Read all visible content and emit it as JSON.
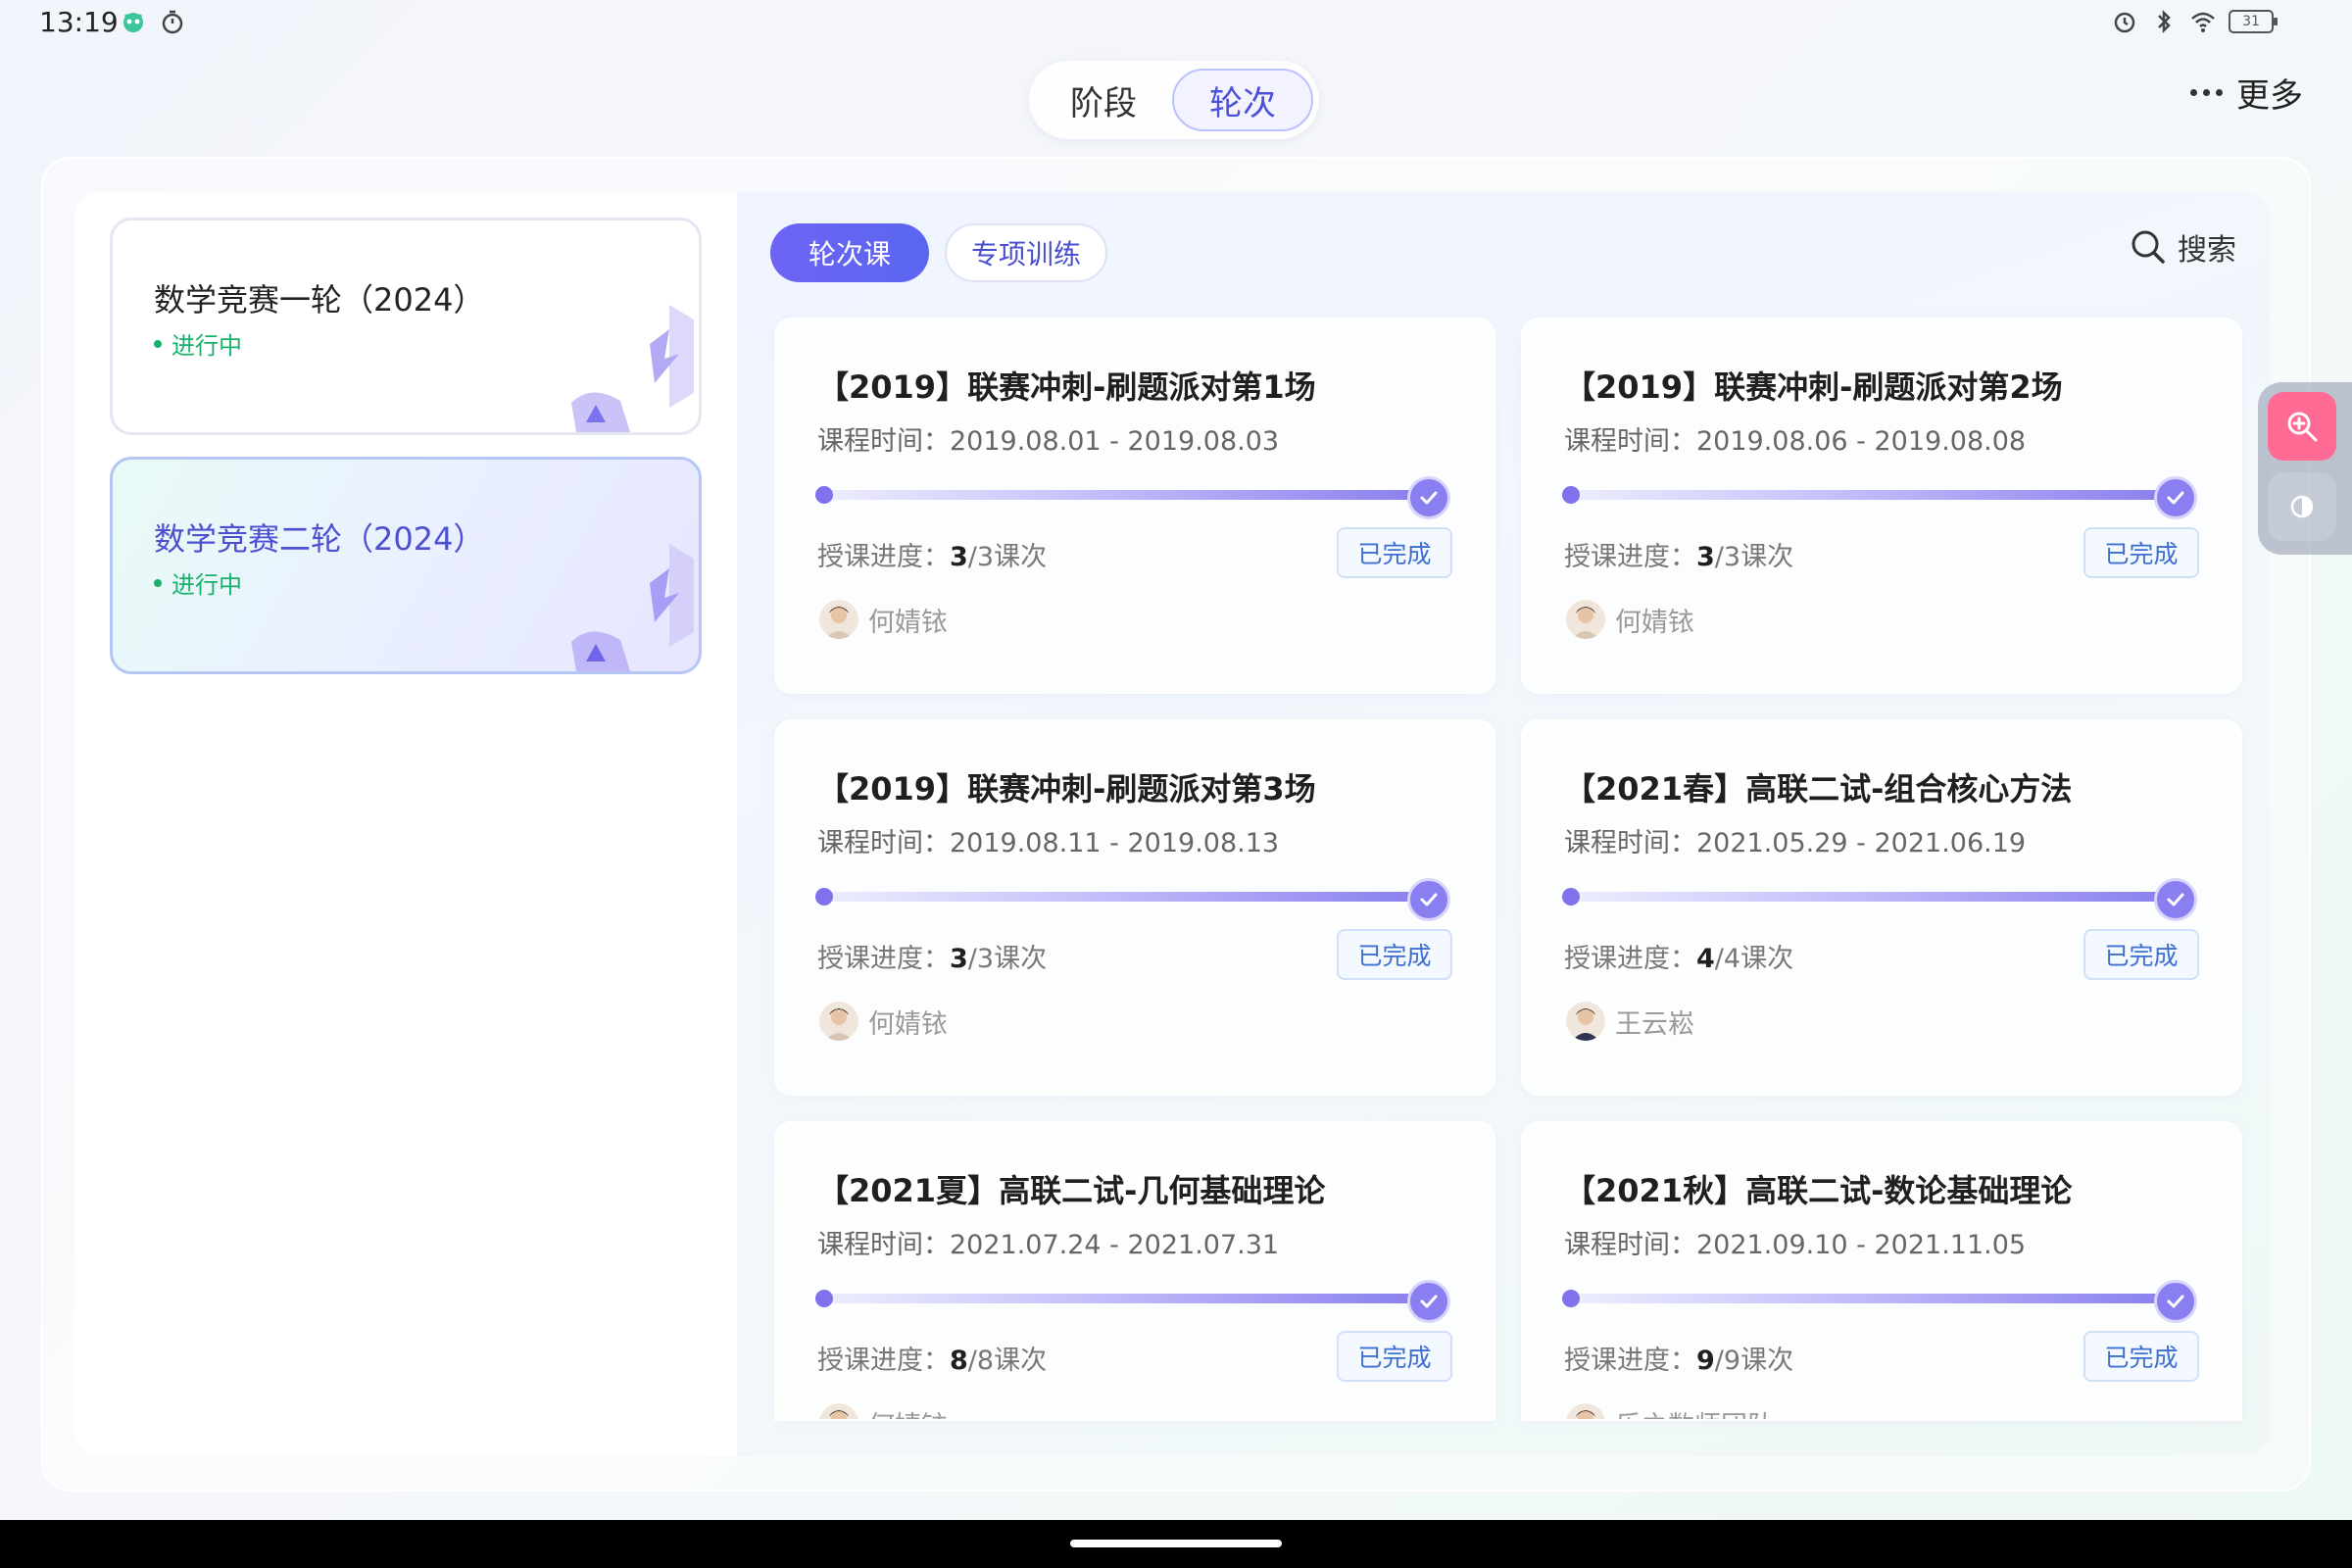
{
  "status_bar": {
    "time": "13:19",
    "battery": "31"
  },
  "top_switch": {
    "items": [
      "阶段",
      "轮次"
    ],
    "active_index": 1
  },
  "more_label": "更多",
  "sidebar": {
    "rounds": [
      {
        "title": "数学竞赛一轮（2024）",
        "status": "进行中",
        "selected": false
      },
      {
        "title": "数学竞赛二轮（2024）",
        "status": "进行中",
        "selected": true
      }
    ]
  },
  "tabs": {
    "active": "轮次课",
    "inactive": "专项训练"
  },
  "search_label": "搜索",
  "labels": {
    "time_prefix": "课程时间：",
    "progress_prefix": "授课进度：",
    "progress_unit": "课次"
  },
  "courses": [
    {
      "title": "【2019】联赛冲刺-刷题派对第1场",
      "time": "2019.08.01 - 2019.08.03",
      "done": "3",
      "total": "3",
      "status": "已完成",
      "teacher": "何婧铱"
    },
    {
      "title": "【2019】联赛冲刺-刷题派对第2场",
      "time": "2019.08.06 - 2019.08.08",
      "done": "3",
      "total": "3",
      "status": "已完成",
      "teacher": "何婧铱"
    },
    {
      "title": "【2019】联赛冲刺-刷题派对第3场",
      "time": "2019.08.11 - 2019.08.13",
      "done": "3",
      "total": "3",
      "status": "已完成",
      "teacher": "何婧铱"
    },
    {
      "title": "【2021春】高联二试-组合核心方法",
      "time": "2021.05.29 - 2021.06.19",
      "done": "4",
      "total": "4",
      "status": "已完成",
      "teacher": "王云崧"
    },
    {
      "title": "【2021夏】高联二试-几何基础理论",
      "time": "2021.07.24 - 2021.07.31",
      "done": "8",
      "total": "8",
      "status": "已完成",
      "teacher": "何婧铱"
    },
    {
      "title": "【2021秋】高联二试-数论基础理论",
      "time": "2021.09.10 - 2021.11.05",
      "done": "9",
      "total": "9",
      "status": "已完成",
      "teacher": "乐之数师团队"
    }
  ],
  "colors": {
    "accent": "#5b5fe6",
    "status_green": "#17b26a",
    "badge_blue": "#3d6fd0",
    "zoom_tool": "#ff6b95"
  }
}
